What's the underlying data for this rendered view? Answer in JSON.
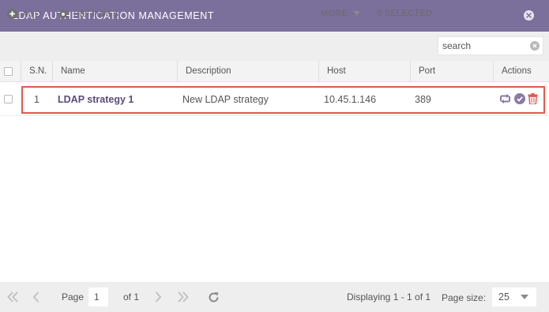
{
  "window": {
    "title": "LDAP AUTHENTICATION MANAGEMENT"
  },
  "toolbar": {
    "add_label": "ADD",
    "settings_label": "SETTINGS",
    "more_label": "MORE",
    "selected_label": "0 SELECTED",
    "search_value": "search"
  },
  "columns": {
    "sn": "S.N.",
    "name": "Name",
    "description": "Description",
    "host": "Host",
    "port": "Port",
    "actions": "Actions"
  },
  "rows": [
    {
      "sn": "1",
      "name": "LDAP strategy 1",
      "description": "New LDAP strategy",
      "host": "10.45.1.146",
      "port": "389"
    }
  ],
  "pagination": {
    "page_label": "Page",
    "page_value": "1",
    "of_label": "of 1",
    "displaying": "Displaying 1 - 1 of 1",
    "page_size_label": "Page size:",
    "page_size_value": "25"
  },
  "colors": {
    "titlebar": "#7b6f9b",
    "accent": "#7b6f9b",
    "delete": "#e2584e",
    "highlight": "#e2584e"
  },
  "icons": [
    "close-icon",
    "add-icon",
    "gear-icon",
    "chevron-down-icon",
    "clear-search-icon",
    "refresh-icon",
    "check-icon",
    "trash-icon",
    "first-page-icon",
    "prev-page-icon",
    "next-page-icon",
    "last-page-icon",
    "reload-icon"
  ]
}
